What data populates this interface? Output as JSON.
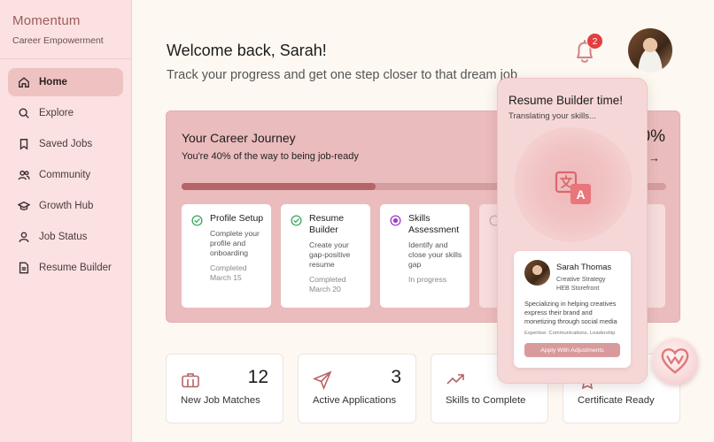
{
  "brand": {
    "name": "Momentum",
    "subtitle": "Career Empowerment"
  },
  "sidebar": {
    "items": [
      {
        "label": "Home",
        "icon": "home-icon",
        "active": true
      },
      {
        "label": "Explore",
        "icon": "search-icon"
      },
      {
        "label": "Saved Jobs",
        "icon": "bookmark-icon"
      },
      {
        "label": "Community",
        "icon": "users-icon"
      },
      {
        "label": "Growth Hub",
        "icon": "graduation-cap-icon"
      },
      {
        "label": "Job Status",
        "icon": "user-icon"
      },
      {
        "label": "Resume Builder",
        "icon": "document-icon"
      }
    ]
  },
  "header": {
    "welcome": "Welcome back, Sarah!",
    "tagline": "Track your progress and get one step closer to that dream job",
    "notification_count": "2"
  },
  "journey": {
    "title": "Your Career Journey",
    "subtitle": "You're 40% of the way to being job-ready",
    "percent_label": "40%",
    "progress": 0.4,
    "arrow": "→",
    "steps": [
      {
        "title": "Profile Setup",
        "desc": "Complete your profile and onboarding",
        "status": "Completed March 15",
        "icon": "check-circle-icon"
      },
      {
        "title": "Resume Builder",
        "desc": "Create your gap-positive resume",
        "status": "Completed March 20",
        "icon": "check-circle-icon"
      },
      {
        "title": "Skills Assessment",
        "desc": "Identify and close your skills gap",
        "status": "In progress",
        "icon": "in-progress-icon"
      }
    ]
  },
  "stats": [
    {
      "number": "12",
      "label": "New Job Matches",
      "icon": "briefcase-icon"
    },
    {
      "number": "3",
      "label": "Active Applications",
      "icon": "send-icon"
    },
    {
      "number": "",
      "label": "Skills to Complete",
      "icon": "trending-up-icon"
    },
    {
      "number": "",
      "label": "Certificate Ready",
      "icon": "certificate-icon"
    }
  ],
  "popup": {
    "title": "Resume Builder time!",
    "subtitle": "Translating your skills...",
    "profile": {
      "name": "Sarah Thomas",
      "role": "Creative Strategy",
      "company": "HEB Storefront",
      "description": "Specializing in helping creatives express their brand and monetizing through social media",
      "expertise": "Expertise: Communications, Leadership",
      "button": "Apply With Adjustments"
    }
  },
  "colors": {
    "accent": "#b56468",
    "sidebar_bg": "#fbe1e1",
    "card_bg": "#ebbcbd",
    "badge": "#e23f3f",
    "check": "#3aa65a",
    "progress_purple": "#a03bc4"
  }
}
